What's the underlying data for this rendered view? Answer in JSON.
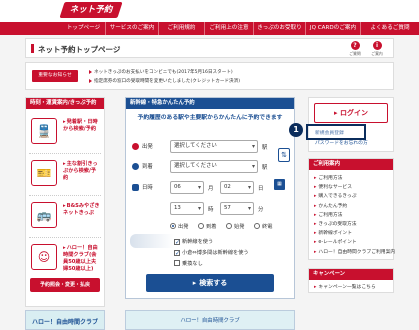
{
  "header": {
    "logo": "ネット予約"
  },
  "nav": [
    {
      "label": "トップページ",
      "w": 43
    },
    {
      "label": "サービスのご案内",
      "w": 53
    },
    {
      "label": "ご利用規約",
      "w": 46
    },
    {
      "label": "ご利用上の注意",
      "w": 49
    },
    {
      "label": "きっぷのお受取り",
      "w": 52
    },
    {
      "label": "JQ CARDのご案内",
      "w": 55
    },
    {
      "label": "よくあるご質問",
      "w": 59
    }
  ],
  "page": {
    "title": "ネット予約トップページ",
    "icons": [
      {
        "label": "ご質問",
        "glyph": "?"
      },
      {
        "label": "ご案内",
        "glyph": "i"
      }
    ]
  },
  "news": {
    "badge": "重要なお知らせ",
    "lines": [
      "ネットきっぷのお支払いをコンビニでも(2017年5月16日スタート)",
      "指定席券の窓口の受取時間を変更いたしました(クレジットカード決済)"
    ]
  },
  "left": {
    "header": "時刻・運賃案内/きっぷ予約",
    "items": [
      {
        "text": "発着駅・日時から検索/予約",
        "glyph": "🚆"
      },
      {
        "text": "主な割引きっぷから検索/予約",
        "glyph": "🎫"
      },
      {
        "text": "B&Sみやざきネットきっぷ",
        "glyph": "🚌"
      },
      {
        "text": "ハロー！自由時間クラブ(会員50歳以上夫婦50歳以上)",
        "glyph": "☺"
      }
    ],
    "button": "予約照会・変更・払戻",
    "banner": "ハロー！自由時間クラブ"
  },
  "search": {
    "header": "新幹線・特急かんたん予約",
    "lead": "予約履歴のある駅や主要駅からかんたんに予約できます",
    "from_label": "出発",
    "to_label": "到着",
    "date_label": "日時",
    "from_value": "選択してください",
    "to_value": "選択してください",
    "station_unit": "駅",
    "month": "06",
    "month_unit": "月",
    "day": "02",
    "day_unit": "日",
    "hour": "13",
    "hour_unit": "時",
    "minute": "57",
    "minute_unit": "分",
    "radios": [
      "出発",
      "到着",
      "始発",
      "終電"
    ],
    "selected_radio": "出発",
    "checks": [
      {
        "label": "新幹線を使う",
        "checked": true
      },
      {
        "label": "小倉⇔博多間は新幹線を使う",
        "checked": true
      },
      {
        "label": "乗換なし",
        "checked": false
      }
    ],
    "button": "検索する"
  },
  "right": {
    "login": "ログイン",
    "new_member": "新規会員登録",
    "forgot": "パスワードをお忘れの方",
    "callout": "1",
    "guide_header": "ご利用案内",
    "guide_items": [
      "ご利用方法",
      "便利なサービス",
      "購入できるきっぷ",
      "かんたん予約",
      "ご利用方法",
      "きっぷの受取方法",
      "新幹線ポイント",
      "e-レールポイント",
      "ハロー！自由時間クラブご利用案内"
    ],
    "camp_header": "キャンペーン",
    "camp_link": "キャンペーン一覧はこちら"
  },
  "bottom": {
    "center": "ハロー！自由時間クラブ"
  },
  "colors": {
    "brand": "#c8102e",
    "search": "#1b4f93",
    "callout": "#0b2d5c"
  }
}
